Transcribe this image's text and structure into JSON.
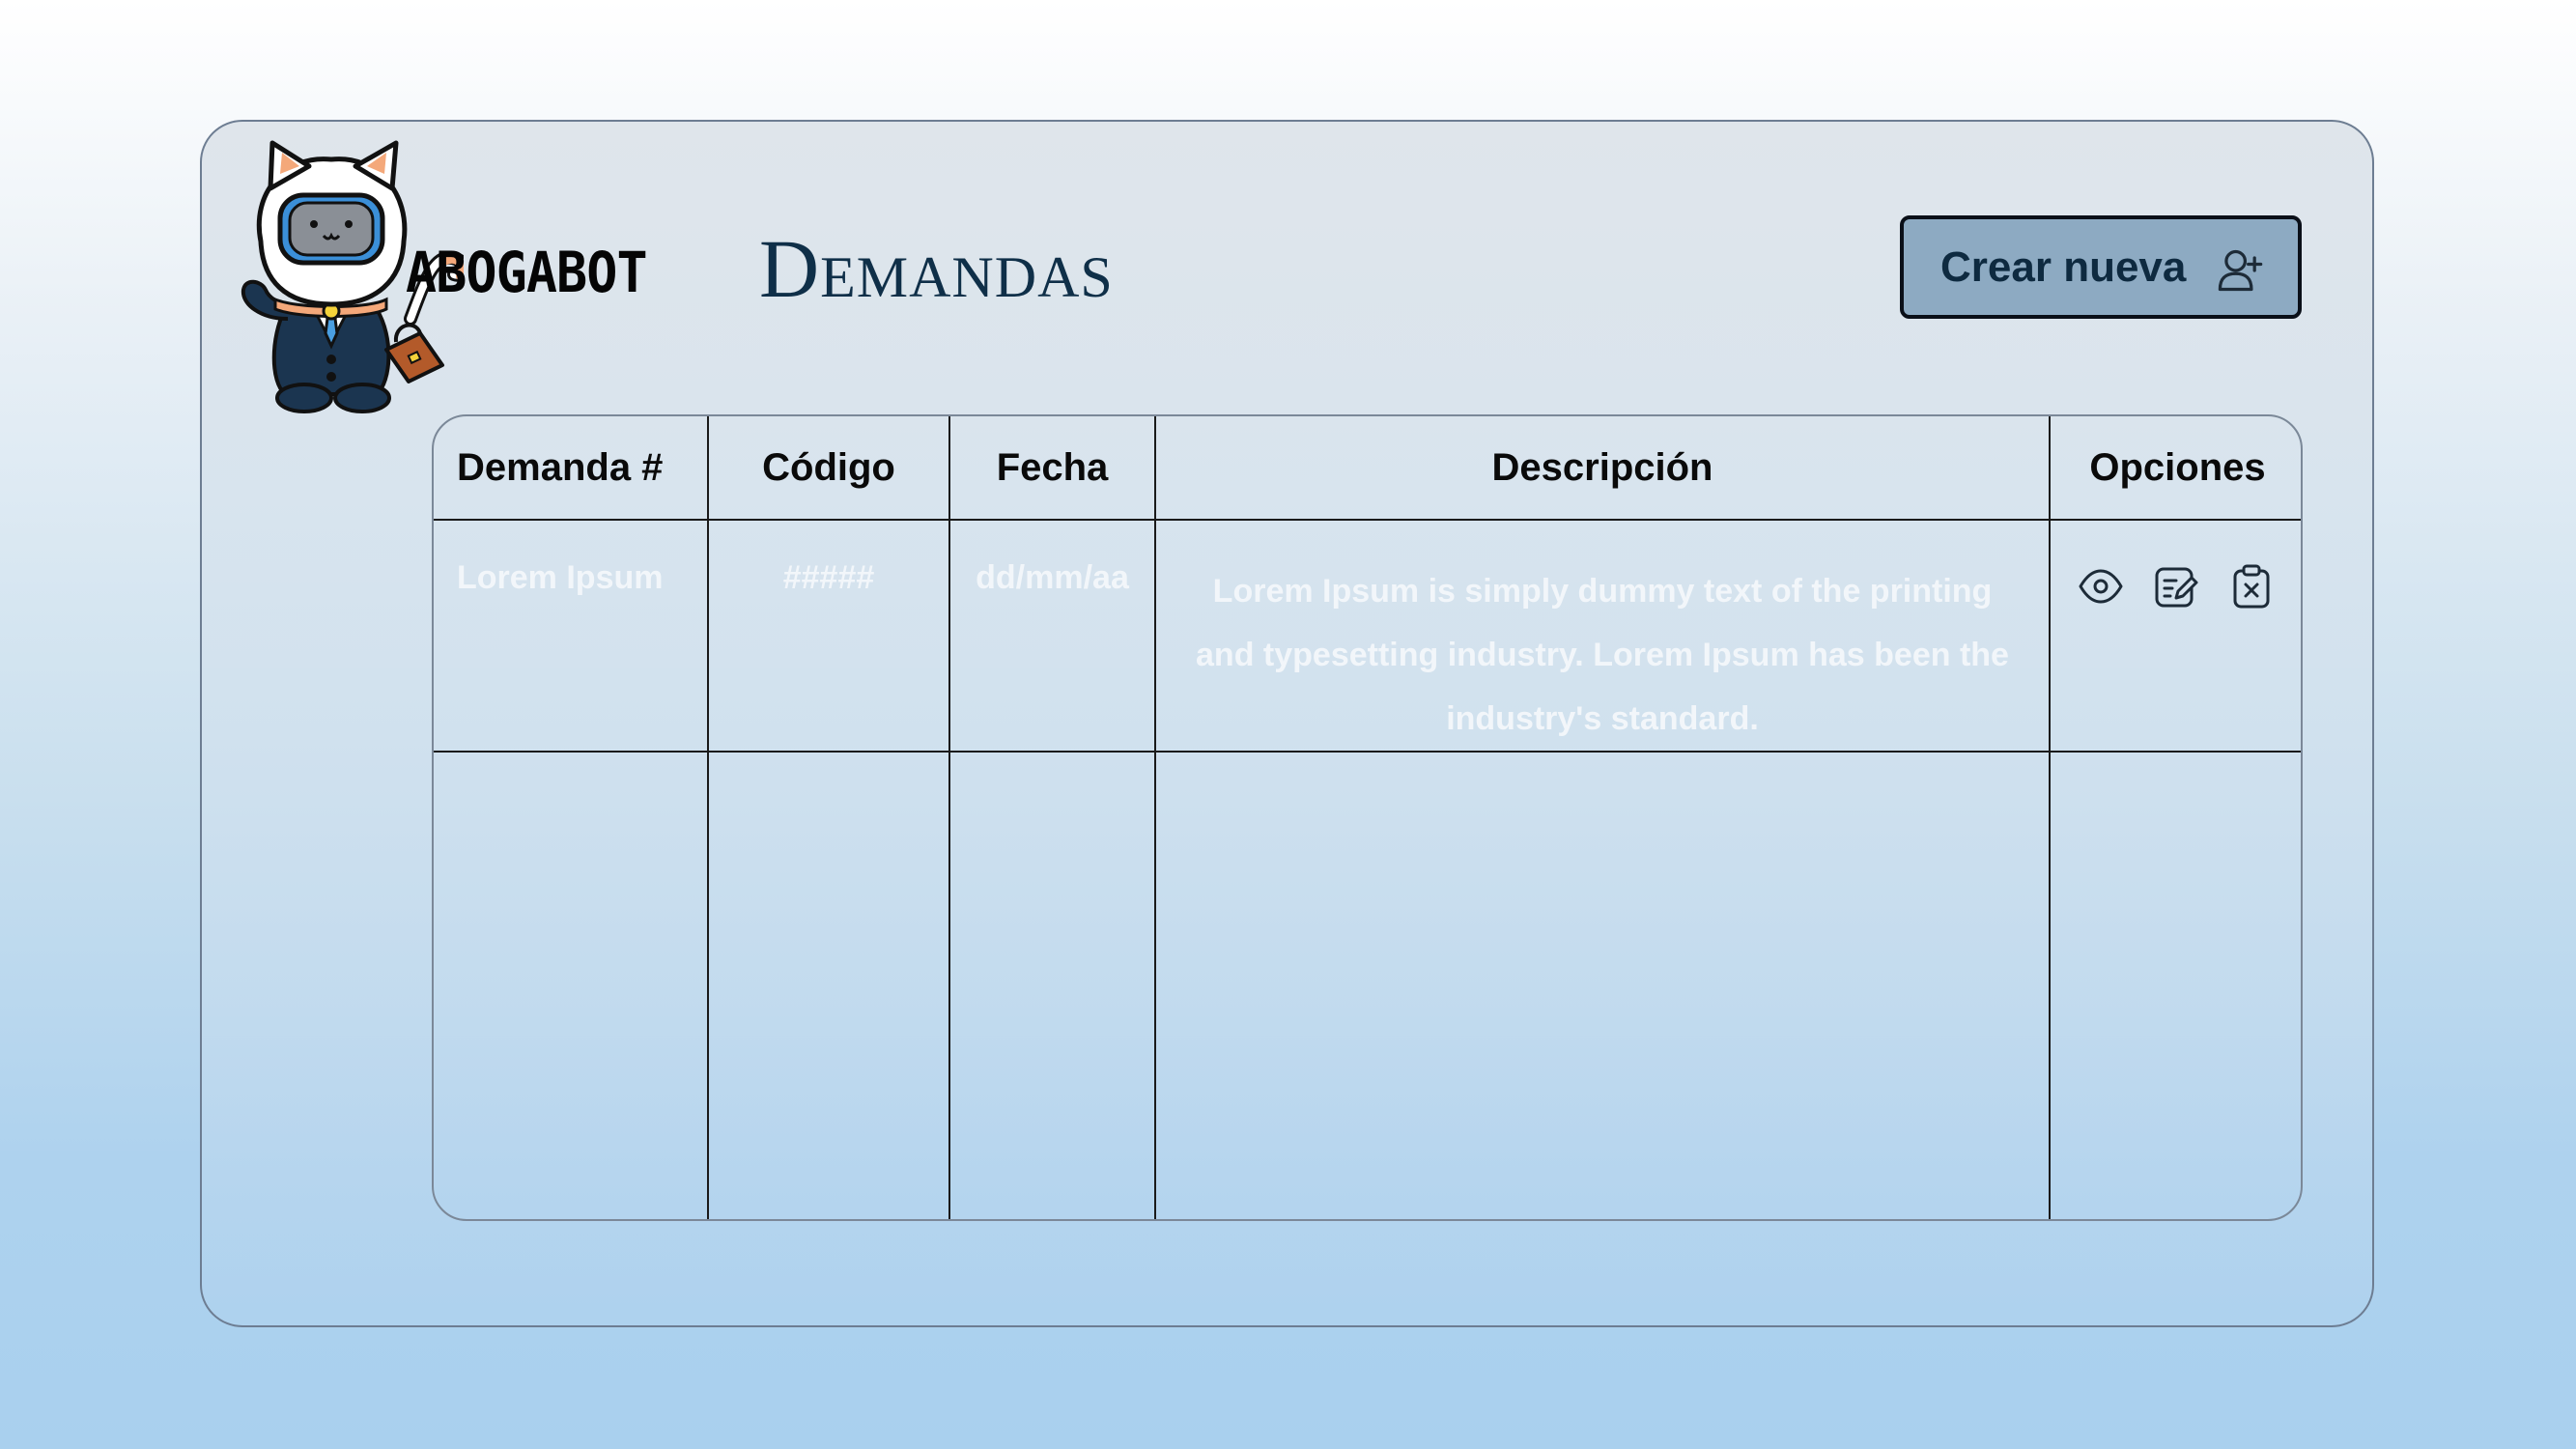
{
  "brand": {
    "name": "ABOGABOT",
    "mascot_icon": "cat-astronaut-lawyer-icon"
  },
  "header": {
    "title": "Demandas",
    "create_button": {
      "label": "Crear nueva",
      "icon": "add-user-icon"
    }
  },
  "table": {
    "columns": [
      "Demanda #",
      "Código",
      "Fecha",
      "Descripción",
      "Opciones"
    ],
    "rows": [
      {
        "demanda": "Lorem Ipsum",
        "codigo": "#####",
        "fecha": "dd/mm/aa",
        "descripcion": "Lorem Ipsum is simply dummy text of the printing and typesetting industry. Lorem Ipsum has been the industry's standard.",
        "options": [
          "eye-icon",
          "edit-icon",
          "clipboard-x-icon"
        ]
      }
    ]
  },
  "colors": {
    "title": "#0f2f48",
    "button_bg": "#8daac2",
    "button_text": "#0e2a40",
    "row_text": "#f2f6fa"
  }
}
